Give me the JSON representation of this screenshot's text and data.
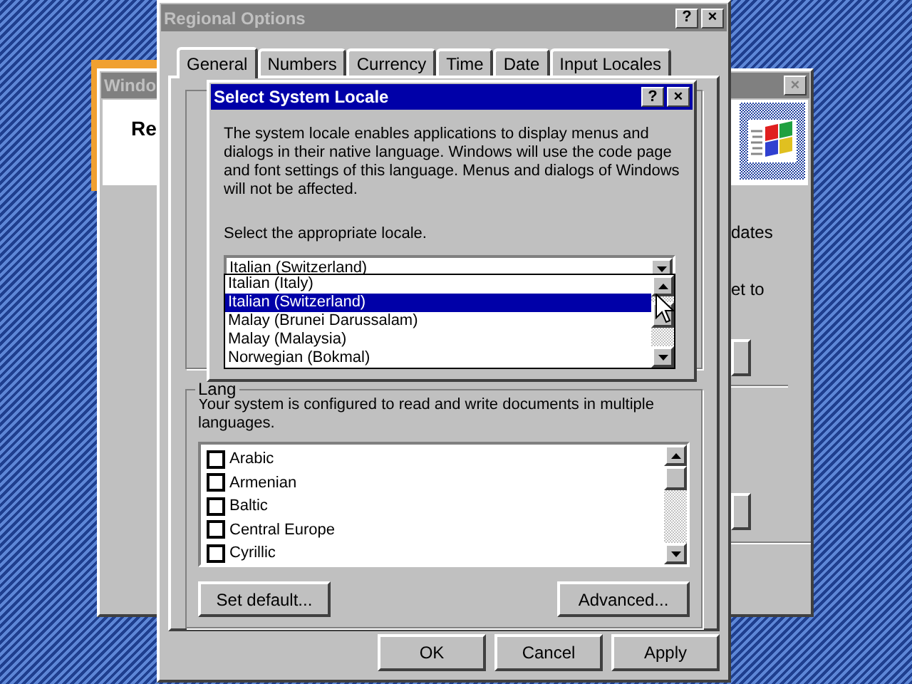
{
  "back_window": {
    "title": "Windo",
    "close_button": "×",
    "heading": "Re",
    "text_1": "dates",
    "text_2": "et to"
  },
  "regional_options": {
    "title": "Regional Options",
    "title_buttons": [
      "?",
      "×"
    ],
    "tabs": [
      {
        "label": "General",
        "selected": true
      },
      {
        "label": "Numbers",
        "selected": false
      },
      {
        "label": "Currency",
        "selected": false
      },
      {
        "label": "Time",
        "selected": false
      },
      {
        "label": "Date",
        "selected": false
      },
      {
        "label": "Input Locales",
        "selected": false
      }
    ],
    "language_group": {
      "label": "Lang",
      "description": "Your system is configured to read and write documents in multiple languages.",
      "items": [
        {
          "label": "Arabic",
          "checked": false
        },
        {
          "label": "Armenian",
          "checked": false
        },
        {
          "label": "Baltic",
          "checked": false
        },
        {
          "label": "Central Europe",
          "checked": false
        },
        {
          "label": "Cyrillic",
          "checked": false
        }
      ],
      "buttons": [
        "Set default...",
        "Advanced..."
      ]
    },
    "buttons": [
      "OK",
      "Cancel",
      "Apply"
    ]
  },
  "locale_dialog": {
    "title": "Select System Locale",
    "title_buttons": [
      "?",
      "×"
    ],
    "description": "The system locale enables applications to display menus and dialogs in their native language.  Windows will use the code page and font settings of this language.  Menus and dialogs of Windows will not be affected.",
    "prompt": "Select the appropriate locale.",
    "combo_value": "Italian (Switzerland)",
    "options": [
      {
        "label": "Italian (Italy)",
        "selected": false
      },
      {
        "label": "Italian (Switzerland)",
        "selected": true
      },
      {
        "label": "Malay (Brunei Darussalam)",
        "selected": false
      },
      {
        "label": "Malay (Malaysia)",
        "selected": false
      },
      {
        "label": "Norwegian (Bokmal)",
        "selected": false
      }
    ]
  }
}
